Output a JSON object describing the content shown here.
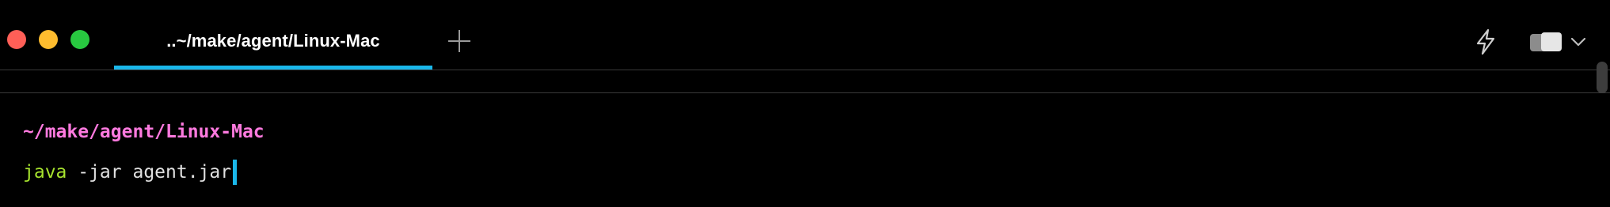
{
  "window": {
    "controls": {
      "close_color": "#ff5f57",
      "minimize_color": "#febc2e",
      "zoom_color": "#28c840"
    }
  },
  "tabs": [
    {
      "label": "..~/make/agent/Linux-Mac",
      "active": true
    }
  ],
  "toolbar": {
    "new_tab_icon": "plus-icon",
    "actions": [
      {
        "icon": "lightning-bolt-icon"
      },
      {
        "icon": "split-pane-icon"
      },
      {
        "icon": "chevron-down-icon"
      }
    ]
  },
  "terminal": {
    "prompt_path": "~/make/agent/Linux-Mac",
    "command": {
      "name": "java",
      "args": " -jar agent.jar"
    }
  },
  "colors": {
    "accent": "#1ab7ea",
    "prompt_path": "#ff7adf",
    "command_name": "#a6e22e",
    "command_args": "#e0e0e0",
    "background": "#000000"
  }
}
